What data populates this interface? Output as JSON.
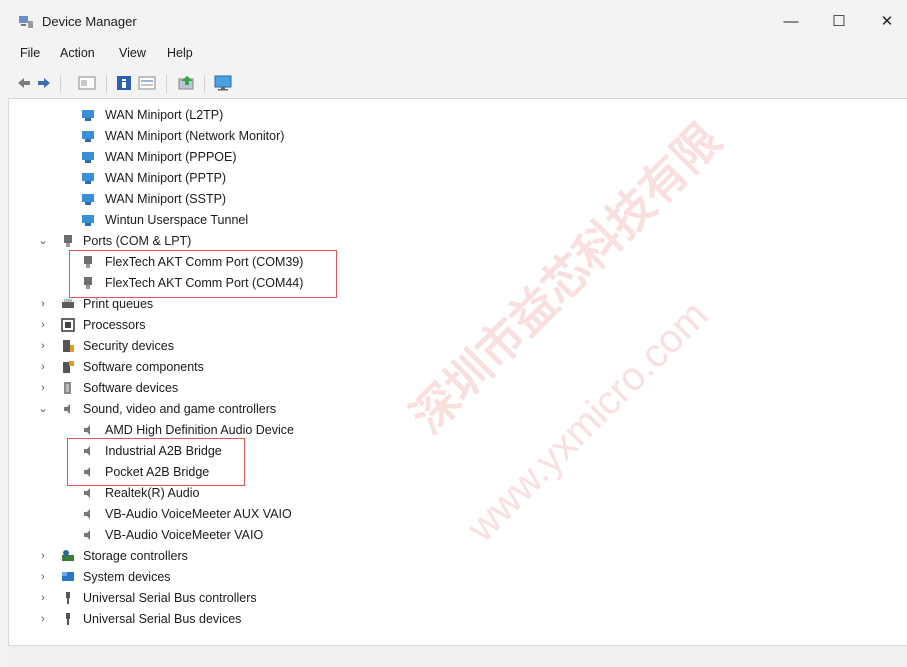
{
  "window": {
    "title": "Device Manager",
    "minimize_glyph": "—",
    "maximize_glyph": "☐",
    "close_glyph": "✕"
  },
  "menu": [
    "File",
    "Action",
    "View",
    "Help"
  ],
  "toolbar": [
    "back-arrow-icon",
    "forward-arrow-icon",
    "show-hide-icon",
    "properties-icon",
    "view-icon",
    "update-driver-icon",
    "monitor-scan-icon"
  ],
  "tree": {
    "network_children": [
      "WAN Miniport (L2TP)",
      "WAN Miniport (Network Monitor)",
      "WAN Miniport (PPPOE)",
      "WAN Miniport (PPTP)",
      "WAN Miniport (SSTP)",
      "Wintun Userspace Tunnel"
    ],
    "ports": {
      "label": "Ports (COM & LPT)",
      "children": [
        "FlexTech AKT Comm Port (COM39)",
        "FlexTech AKT Comm Port (COM44)"
      ]
    },
    "categories_a": [
      {
        "label": "Print queues",
        "icon": "printer-icon"
      },
      {
        "label": "Processors",
        "icon": "processor-icon"
      },
      {
        "label": "Security devices",
        "icon": "security-icon"
      },
      {
        "label": "Software components",
        "icon": "software-component-icon"
      },
      {
        "label": "Software devices",
        "icon": "software-device-icon"
      }
    ],
    "sound": {
      "label": "Sound, video and game controllers",
      "children": [
        "AMD High Definition Audio Device",
        "Industrial A2B Bridge",
        "Pocket A2B Bridge",
        "Realtek(R) Audio",
        "VB-Audio VoiceMeeter AUX VAIO",
        "VB-Audio VoiceMeeter VAIO"
      ]
    },
    "categories_b": [
      {
        "label": "Storage controllers",
        "icon": "storage-icon"
      },
      {
        "label": "System devices",
        "icon": "system-icon"
      },
      {
        "label": "Universal Serial Bus controllers",
        "icon": "usb-icon"
      },
      {
        "label": "Universal Serial Bus devices",
        "icon": "usb-icon"
      }
    ],
    "expanded_glyph": "⌄",
    "collapsed_glyph": "›"
  },
  "watermark": {
    "cn": "深圳市益芯科技有限",
    "url": "www.yxmicro.com"
  },
  "colors": {
    "highlight": "#e05757",
    "network_icon": "#3b8fd9",
    "watermark": "#e05050"
  }
}
